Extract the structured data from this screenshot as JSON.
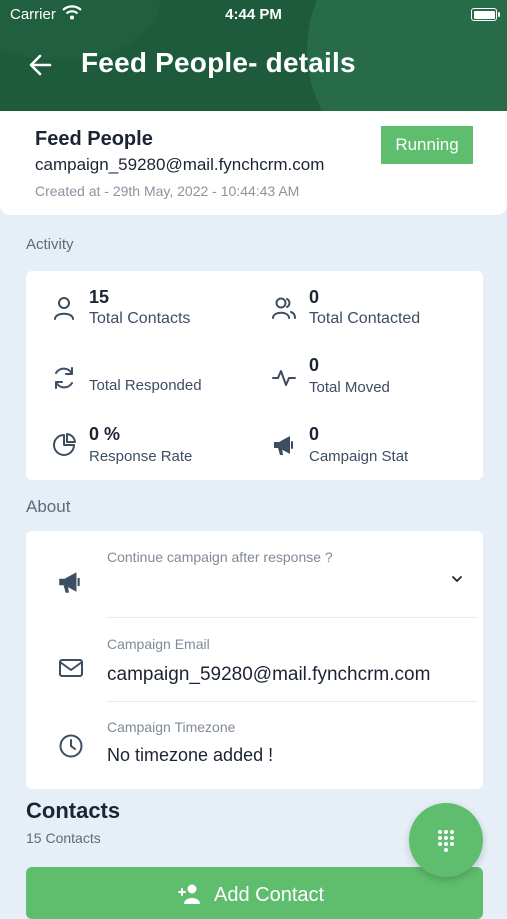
{
  "status_bar": {
    "carrier": "Carrier",
    "time": "4:44 PM"
  },
  "header": {
    "title": "Feed People- details"
  },
  "campaign": {
    "name": "Feed People",
    "email": "campaign_59280@mail.fynchcrm.com",
    "created": "Created at - 29th May, 2022 - 10:44:43 AM",
    "status": "Running"
  },
  "activity": {
    "section_label": "Activity",
    "stats": [
      {
        "value": "15",
        "label": "Total Contacts",
        "icon": "person-icon"
      },
      {
        "value": "0",
        "label": "Total Contacted",
        "icon": "people-icon"
      },
      {
        "value": "",
        "label": "Total Responded",
        "icon": "refresh-icon"
      },
      {
        "value": "0",
        "label": "Total Moved",
        "icon": "activity-icon"
      },
      {
        "value": "0 %",
        "label": "Response Rate",
        "icon": "pie-chart-icon"
      },
      {
        "value": "0",
        "label": "Campaign Stat",
        "icon": "megaphone-icon"
      }
    ]
  },
  "about": {
    "section_label": "About",
    "continue_label": "Continue campaign after response ?",
    "continue_value": "",
    "email_label": "Campaign Email",
    "email_value": "campaign_59280@mail.fynchcrm.com",
    "timezone_label": "Campaign Timezone",
    "timezone_value": "No timezone added !"
  },
  "contacts": {
    "title": "Contacts",
    "count": "15 Contacts",
    "add_button": "Add Contact"
  },
  "colors": {
    "header": "#1e5b3c",
    "accent": "#5fbd6e",
    "background": "#e6eef7"
  }
}
